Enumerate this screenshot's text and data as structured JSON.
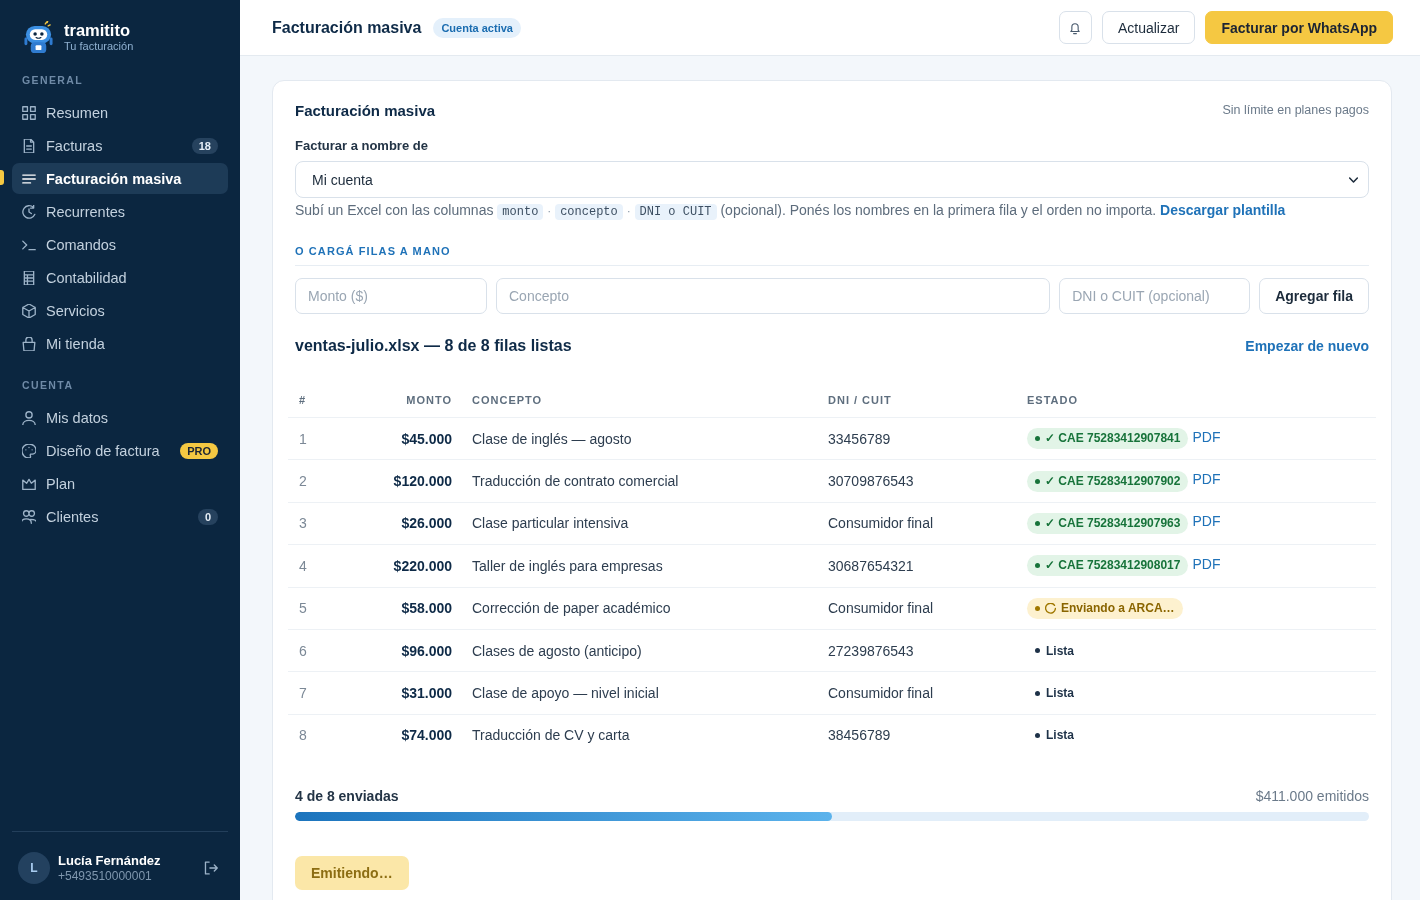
{
  "sidebar": {
    "brand": {
      "name": "tramitito",
      "tagline": "Tu facturación"
    },
    "sections": [
      {
        "title": "GENERAL",
        "items": [
          {
            "label": "Resumen",
            "selected": false
          },
          {
            "label": "Facturas",
            "selected": false,
            "badge": {
              "kind": "count",
              "text": "18"
            }
          },
          {
            "label": "Facturación masiva",
            "selected": true
          },
          {
            "label": "Recurrentes",
            "selected": false
          },
          {
            "label": "Comandos",
            "selected": false
          },
          {
            "label": "Contabilidad",
            "selected": false
          },
          {
            "label": "Servicios",
            "selected": false
          },
          {
            "label": "Mi tienda",
            "selected": false
          }
        ]
      },
      {
        "title": "CUENTA",
        "items": [
          {
            "label": "Mis datos",
            "selected": false
          },
          {
            "label": "Diseño de factura",
            "selected": false,
            "badge": {
              "kind": "pro",
              "text": "PRO"
            }
          },
          {
            "label": "Plan",
            "selected": false
          },
          {
            "label": "Clientes",
            "selected": false,
            "badge": {
              "kind": "count",
              "text": "0"
            }
          }
        ]
      }
    ],
    "user": {
      "initial": "L",
      "name": "Lucía Fernández",
      "phone": "+5493510000001"
    }
  },
  "header": {
    "title": "Facturación masiva",
    "status_badge": "Cuenta activa",
    "buttons": [
      {
        "kind": "icon"
      },
      {
        "kind": "secondary",
        "label": "Actualizar"
      },
      {
        "kind": "primary",
        "label": "Facturar por WhatsApp"
      }
    ]
  },
  "card": {
    "title": "Facturación masiva",
    "note": "Sin límite en planes pagos",
    "select": {
      "label": "Facturar a nombre de",
      "value": "Mi cuenta"
    },
    "help": {
      "parts": [
        {
          "kind": "text",
          "text": "Subí un Excel con las columnas"
        },
        {
          "kind": "code",
          "text": "monto"
        },
        {
          "kind": "sep",
          "text": "·"
        },
        {
          "kind": "code",
          "text": "concepto"
        },
        {
          "kind": "sep",
          "text": "·"
        },
        {
          "kind": "code",
          "text": "DNI o CUIT"
        },
        {
          "kind": "text",
          "text": "(opcional). Ponés los nombres en la primera fila y el orden no importa."
        }
      ],
      "link": "Descargar plantilla"
    },
    "manual": {
      "heading": "O CARGÁ FILAS A MANO",
      "fields": [
        {
          "placeholder": "Monto ($)"
        },
        {
          "placeholder": "Concepto"
        },
        {
          "placeholder": "DNI o CUIT (opcional)"
        }
      ],
      "button": "Agregar fila"
    },
    "file_summary": {
      "title": "ventas-julio.xlsx — 8 de 8 filas listas",
      "link": "Empezar de nuevo"
    },
    "table": {
      "columns": [
        "#",
        "MONTO",
        "CONCEPTO",
        "DNI / CUIT",
        "ESTADO"
      ],
      "rows": [
        {
          "number": "1",
          "amount": "$45.000",
          "concept": "Clase de inglés — agosto",
          "dni_cuit": "33456789",
          "status": {
            "kind": "done",
            "text": "✓ CAE 75283412907841",
            "link": "PDF"
          }
        },
        {
          "number": "2",
          "amount": "$120.000",
          "concept": "Traducción de contrato comercial",
          "dni_cuit": "30709876543",
          "status": {
            "kind": "done",
            "text": "✓ CAE 75283412907902",
            "link": "PDF"
          }
        },
        {
          "number": "3",
          "amount": "$26.000",
          "concept": "Clase particular intensiva",
          "dni_cuit": "Consumidor final",
          "status": {
            "kind": "done",
            "text": "✓ CAE 75283412907963",
            "link": "PDF"
          }
        },
        {
          "number": "4",
          "amount": "$220.000",
          "concept": "Taller de inglés para empresas",
          "dni_cuit": "30687654321",
          "status": {
            "kind": "done",
            "text": "✓ CAE 75283412908017",
            "link": "PDF"
          }
        },
        {
          "number": "5",
          "amount": "$58.000",
          "concept": "Corrección de paper académico",
          "dni_cuit": "Consumidor final",
          "status": {
            "kind": "sending",
            "text": "Enviando a ARCA…"
          }
        },
        {
          "number": "6",
          "amount": "$96.000",
          "concept": "Clases de agosto (anticipo)",
          "dni_cuit": "27239876543",
          "status": {
            "kind": "ready",
            "text": "Lista"
          }
        },
        {
          "number": "7",
          "amount": "$31.000",
          "concept": "Clase de apoyo — nivel inicial",
          "dni_cuit": "Consumidor final",
          "status": {
            "kind": "ready",
            "text": "Lista"
          }
        },
        {
          "number": "8",
          "amount": "$74.000",
          "concept": "Traducción de CV y carta",
          "dni_cuit": "38456789",
          "status": {
            "kind": "ready",
            "text": "Lista"
          }
        }
      ]
    },
    "progress": {
      "label": "4 de 8 enviadas",
      "total": "$411.000 emitidos",
      "level": 0.5
    },
    "emit_button": {
      "label": "Emitiendo…",
      "disabled": true
    }
  }
}
